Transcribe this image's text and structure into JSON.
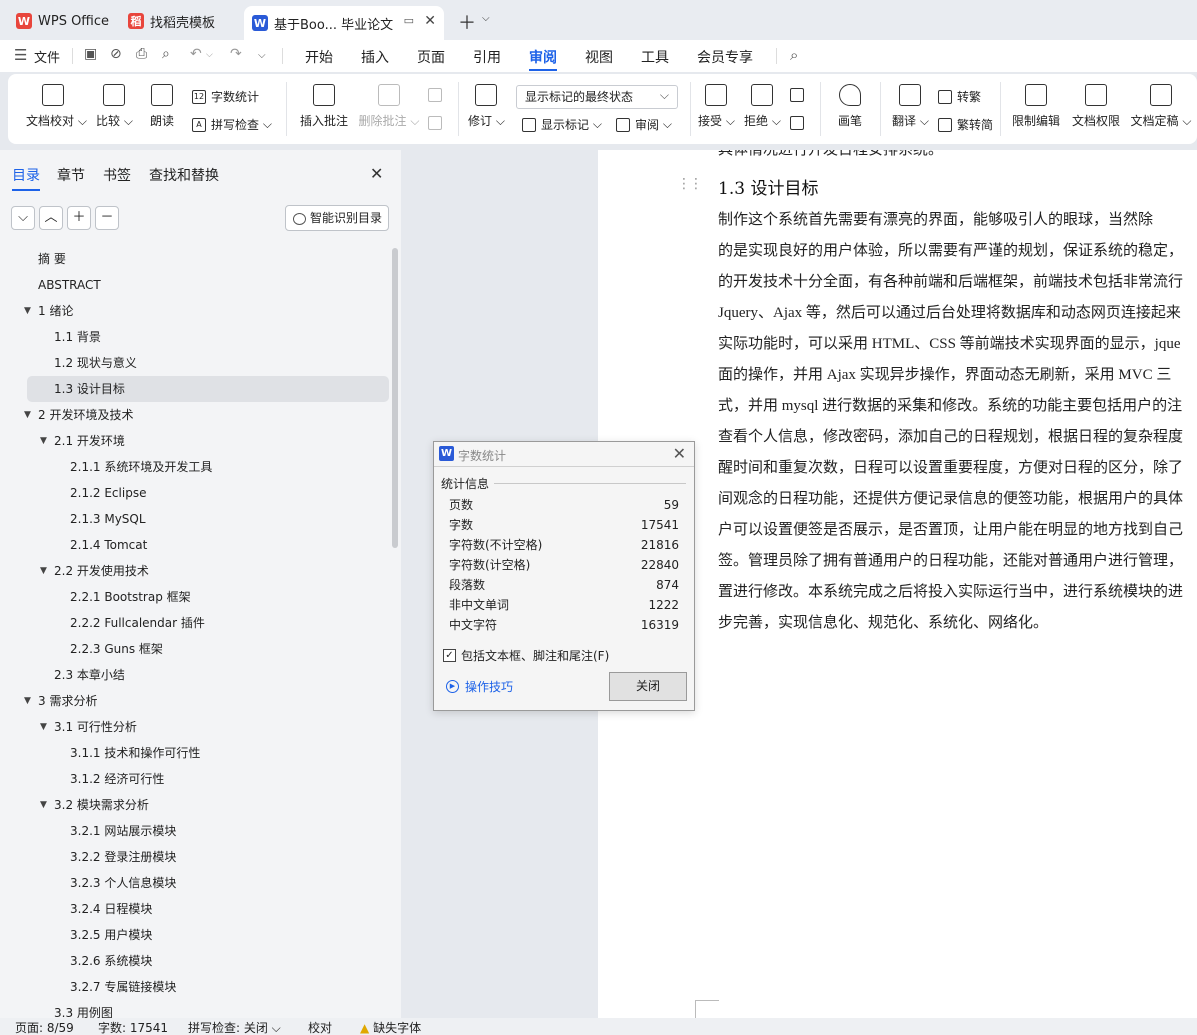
{
  "tabs": [
    {
      "label": "WPS Office",
      "logo": "W",
      "logo_color": "#e8453c"
    },
    {
      "label": "找稻壳模板",
      "logo": "稻",
      "logo_color": "#e8453c"
    },
    {
      "label": "基于Boo... 毕业论文",
      "logo": "W",
      "logo_color": "#2a5ad7"
    }
  ],
  "menu": {
    "file": "文件",
    "items": [
      "开始",
      "插入",
      "页面",
      "引用",
      "审阅",
      "视图",
      "工具",
      "会员专享"
    ],
    "active": "审阅"
  },
  "ribbon": {
    "doc_check": "文档校对",
    "compare": "比较",
    "read_aloud": "朗读",
    "word_count": "字数统计",
    "spell_check": "拼写检查",
    "insert_comment": "插入批注",
    "delete_comment": "删除批注",
    "revise": "修订",
    "display_mode": "显示标记的最终状态",
    "show_markup": "显示标记",
    "review": "审阅",
    "accept": "接受",
    "reject": "拒绝",
    "pen": "画笔",
    "translate": "翻译",
    "to_traditional": "转繁",
    "to_simplified": "繁转简",
    "restrict_edit": "限制编辑",
    "doc_permission": "文档权限",
    "doc_finalize": "文档定稿"
  },
  "nav_panel": {
    "tabs": [
      "目录",
      "章节",
      "书签",
      "查找和替换"
    ],
    "active_tab": "目录",
    "smart_toc_label": "智能识别目录",
    "toc": [
      {
        "label": "摘    要",
        "level": 0,
        "arrow": ""
      },
      {
        "label": "ABSTRACT",
        "level": 0,
        "arrow": ""
      },
      {
        "label": "1  绪论",
        "level": 0,
        "arrow": "▼"
      },
      {
        "label": "1.1  背景",
        "level": 1,
        "arrow": ""
      },
      {
        "label": "1.2  现状与意义",
        "level": 1,
        "arrow": ""
      },
      {
        "label": "1.3  设计目标",
        "level": 1,
        "arrow": "",
        "selected": true
      },
      {
        "label": "2  开发环境及技术",
        "level": 0,
        "arrow": "▼"
      },
      {
        "label": "2.1  开发环境",
        "level": 1,
        "arrow": "▼"
      },
      {
        "label": "2.1.1  系统环境及开发工具",
        "level": 2,
        "arrow": ""
      },
      {
        "label": "2.1.2 Eclipse",
        "level": 2,
        "arrow": ""
      },
      {
        "label": "2.1.3 MySQL",
        "level": 2,
        "arrow": ""
      },
      {
        "label": "2.1.4 Tomcat",
        "level": 2,
        "arrow": ""
      },
      {
        "label": "2.2  开发使用技术",
        "level": 1,
        "arrow": "▼"
      },
      {
        "label": "2.2.1 Bootstrap 框架",
        "level": 2,
        "arrow": ""
      },
      {
        "label": "2.2.2 Fullcalendar 插件",
        "level": 2,
        "arrow": ""
      },
      {
        "label": "2.2.3 Guns 框架",
        "level": 2,
        "arrow": ""
      },
      {
        "label": "2.3  本章小结",
        "level": 1,
        "arrow": ""
      },
      {
        "label": "3  需求分析",
        "level": 0,
        "arrow": "▼"
      },
      {
        "label": "3.1  可行性分析",
        "level": 1,
        "arrow": "▼"
      },
      {
        "label": "3.1.1 技术和操作可行性",
        "level": 2,
        "arrow": ""
      },
      {
        "label": "3.1.2 经济可行性",
        "level": 2,
        "arrow": ""
      },
      {
        "label": "3.2  模块需求分析",
        "level": 1,
        "arrow": "▼"
      },
      {
        "label": "3.2.1  网站展示模块",
        "level": 2,
        "arrow": ""
      },
      {
        "label": "3.2.2  登录注册模块",
        "level": 2,
        "arrow": ""
      },
      {
        "label": "3.2.3  个人信息模块",
        "level": 2,
        "arrow": ""
      },
      {
        "label": "3.2.4  日程模块",
        "level": 2,
        "arrow": ""
      },
      {
        "label": "3.2.5  用户模块",
        "level": 2,
        "arrow": ""
      },
      {
        "label": "3.2.6  系统模块",
        "level": 2,
        "arrow": ""
      },
      {
        "label": "3.2.7  专属链接模块",
        "level": 2,
        "arrow": ""
      },
      {
        "label": "3.3  用例图",
        "level": 1,
        "arrow": ""
      }
    ]
  },
  "document": {
    "top_fragment": "具体情况进行开发日程安排系统。",
    "heading": "1.3  设计目标",
    "lines": [
      "    制作这个系统首先需要有漂亮的界面，能够吸引人的眼球，当然除",
      "的是实现良好的用户体验，所以需要有严谨的规划，保证系统的稳定，",
      "的开发技术十分全面，有各种前端和后端框架，前端技术包括非常流行",
      "Jquery、Ajax 等，然后可以通过后台处理将数据库和动态网页连接起来",
      "实际功能时，可以采用 HTML、CSS 等前端技术实现界面的显示，jque",
      "面的操作，并用 Ajax 实现异步操作，界面动态无刷新，采用 MVC 三",
      "式，并用 mysql 进行数据的采集和修改。系统的功能主要包括用户的注",
      "查看个人信息，修改密码，添加自己的日程规划，根据日程的复杂程度",
      "醒时间和重复次数，日程可以设置重要程度，方便对日程的区分，除了",
      "间观念的日程功能，还提供方便记录信息的便签功能，根据用户的具体",
      "户可以设置便签是否展示，是否置顶，让用户能在明显的地方找到自己",
      "签。管理员除了拥有普通用户的日程功能，还能对普通用户进行管理，",
      "置进行修改。本系统完成之后将投入实际运行当中，进行系统模块的进",
      "步完善，实现信息化、规范化、系统化、网络化。"
    ]
  },
  "dialog": {
    "title": "字数统计",
    "section": "统计信息",
    "rows": [
      {
        "label": "页数",
        "value": "59"
      },
      {
        "label": "字数",
        "value": "17541"
      },
      {
        "label": "字符数(不计空格)",
        "value": "21816"
      },
      {
        "label": "字符数(计空格)",
        "value": "22840"
      },
      {
        "label": "段落数",
        "value": "874"
      },
      {
        "label": "非中文单词",
        "value": "1222"
      },
      {
        "label": "中文字符",
        "value": "16319"
      }
    ],
    "checkbox_label": "包括文本框、脚注和尾注(F)",
    "checkbox_checked": true,
    "tips_link": "操作技巧",
    "close_button": "关闭"
  },
  "statusbar": {
    "page": "页面: 8/59",
    "words": "字数: 17541",
    "spell": "拼写检查: 关闭",
    "proof": "校对",
    "missing_font": "缺失字体"
  },
  "colors": {
    "accent": "#1d62e8",
    "wps_red": "#e8453c",
    "writer_blue": "#2a5ad7"
  }
}
